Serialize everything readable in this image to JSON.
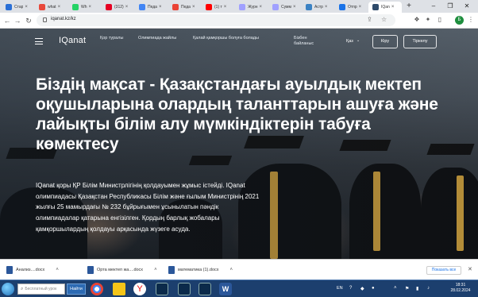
{
  "browser": {
    "tabs": [
      {
        "title": "Стар",
        "color": "#2a6fd6"
      },
      {
        "title": "what",
        "color": "#e8483b"
      },
      {
        "title": "Wh",
        "color": "#25d366"
      },
      {
        "title": "(312)",
        "color": "#e60023"
      },
      {
        "title": "Педа",
        "color": "#4285f4"
      },
      {
        "title": "Педа",
        "color": "#ea4335"
      },
      {
        "title": "(1) т",
        "color": "#ff0000"
      },
      {
        "title": "Журн",
        "color": "#a0a0ff"
      },
      {
        "title": "Сумм",
        "color": "#a0a0ff"
      },
      {
        "title": "Астр",
        "color": "#3b82c4"
      },
      {
        "title": "Отпр",
        "color": "#1a73e8"
      },
      {
        "title": "IQan",
        "color": "#2e4a6a"
      }
    ],
    "url": "iqanat.kz/kz",
    "profile_initial": "Б",
    "new_tab": "+"
  },
  "site": {
    "logo": "IQanat",
    "nav": [
      {
        "label": "Қор туралы"
      },
      {
        "label": "Олимпиада жайлы"
      },
      {
        "label": "Қалай қамқоршы болуға болады"
      },
      {
        "label": "Бізбен байланыс"
      }
    ],
    "language": "Қаз",
    "login": "Кіру",
    "register": "Тіркелу",
    "headline": "Біздің мақсат - Қазақстандағы ауылдық мектеп оқушыларына олардың таланттарын ашуға және лайықты білім алу мүмкіндіктерін табуға көмектесу",
    "body": "IQanat қоры ҚР Білім Министрлігінің қолдауымен жұмыс істейді. IQanat олимпиадасы Қазақстан Республикасы Білім және ғылым Министрінің 2021 жылғы 25 мамырдағы № 232 бұйрығымен ұсынылатын пәндік олимпиадалар қатарына енгізілген. Қордың барлық жобалары қамқоршылардың қолдауы арқасында жүзеге асуда."
  },
  "downloads": {
    "items": [
      {
        "name": "Анализ....docx"
      },
      {
        "name": "Орта мектеп жа....docx"
      },
      {
        "name": "математика (1).docx"
      }
    ],
    "show_all": "Показать все"
  },
  "taskbar": {
    "search_placeholder": "Бесплатный урок",
    "search_button": "Найти",
    "lang": "EN",
    "time": "18:31",
    "date": "28.02.2024"
  },
  "colors": {
    "accent": "#1a73e8",
    "taskbar": "#1c3f6e",
    "stole": "#c79a3a"
  }
}
